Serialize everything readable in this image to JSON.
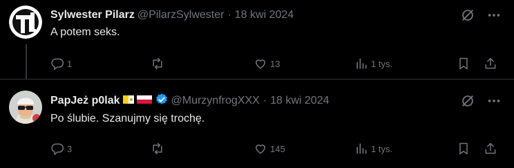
{
  "posts": [
    {
      "display_name": "Sylwester Pilarz",
      "handle": "@PilarzSylwester",
      "separator": "·",
      "date": "18 kwi 2024",
      "text": "A potem seks.",
      "stats": {
        "replies": "1",
        "reposts": "",
        "likes": "13",
        "views": "1 tys."
      },
      "avatar": "logo-avatar"
    },
    {
      "display_name": "PapJeż p0lak",
      "handle": "@MurzynfrogXXX",
      "separator": "·",
      "date": "18 kwi 2024",
      "text": "Po ślubie. Szanujmy się trochę.",
      "stats": {
        "replies": "3",
        "reposts": "",
        "likes": "145",
        "views": "1 tys."
      },
      "badges": [
        "vatican-flag-icon",
        "poland-flag-icon",
        "verified-badge-icon"
      ],
      "avatar": "photo-avatar"
    }
  ],
  "colors": {
    "background": "#000000",
    "text": "#e7e9ea",
    "muted": "#71767b",
    "verified": "#1d9bf0",
    "divider": "#2f3336"
  },
  "icons": [
    "grok-icon",
    "more-icon",
    "reply-icon",
    "repost-icon",
    "like-icon",
    "views-icon",
    "bookmark-icon",
    "share-icon"
  ]
}
